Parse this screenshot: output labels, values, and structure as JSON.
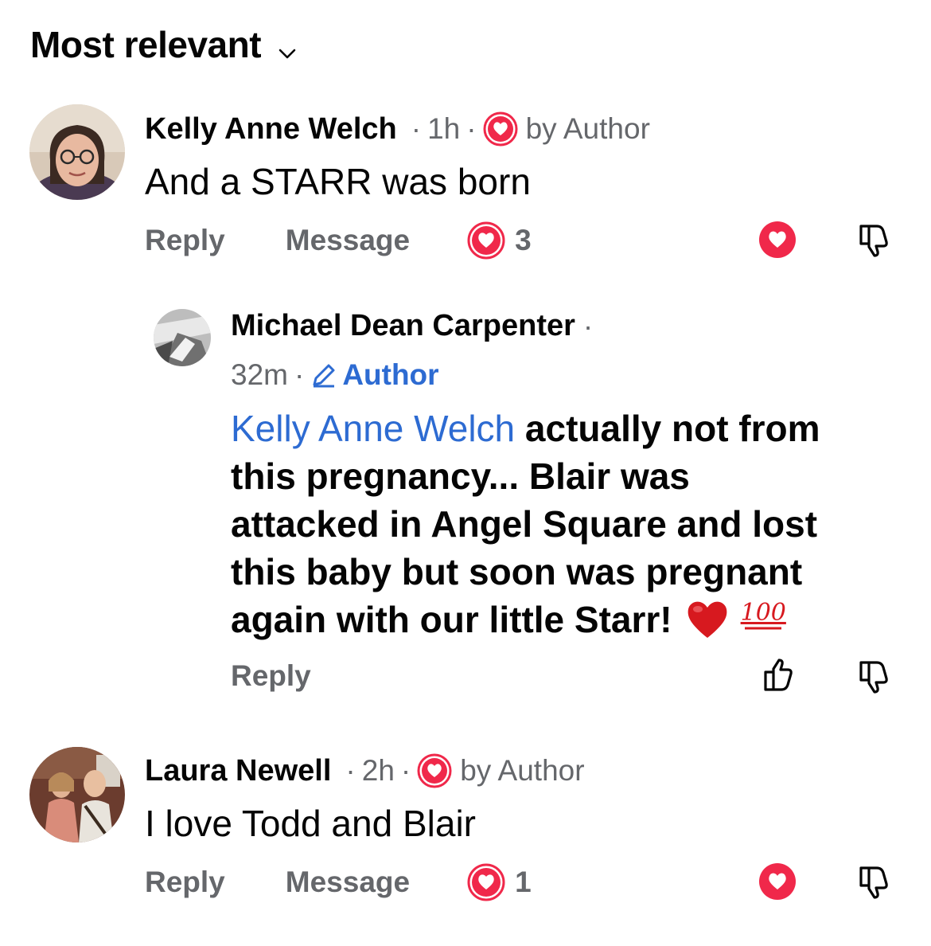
{
  "sort": {
    "label": "Most relevant"
  },
  "comments": [
    {
      "author": "Kelly Anne Welch",
      "time": "1h",
      "badge": "by Author",
      "text": "And a STARR was born",
      "reply_label": "Reply",
      "message_label": "Message",
      "reaction_count": "3"
    },
    {
      "author": "Laura Newell",
      "time": "2h",
      "badge": "by Author",
      "text": "I love Todd and Blair",
      "reply_label": "Reply",
      "message_label": "Message",
      "reaction_count": "1"
    }
  ],
  "reply": {
    "author": "Michael Dean Carpenter",
    "time": "32m",
    "badge": "Author",
    "mention": "Kelly Anne Welch",
    "text_line1": "actually not from",
    "text_line2": "this pregnancy... Blair was",
    "text_line3": "attacked in Angel Square and lost",
    "text_line4": "this baby but soon was pregnant",
    "text_line5": "again with our little Starr!",
    "emoji": "❤️",
    "hundred": "100",
    "reply_label": "Reply"
  },
  "colors": {
    "heart": "#f0284a",
    "link": "#2d6bd2",
    "muted": "#65676b"
  }
}
